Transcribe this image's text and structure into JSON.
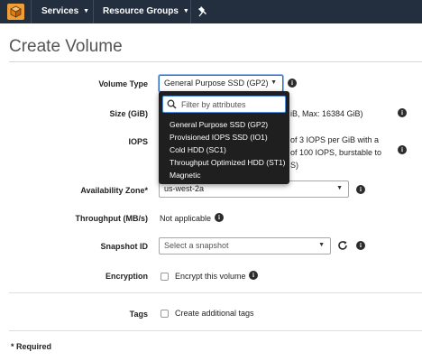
{
  "colors": {
    "topbar": "#232f3e",
    "logo": "#f19d36",
    "dropdown_bg": "#1f1f1f",
    "focus": "#2e6ecb"
  },
  "topbar": {
    "logo_icon": "aws-cube-icon",
    "services_label": "Services",
    "resource_groups_label": "Resource Groups",
    "pin_icon": "pin-icon"
  },
  "page": {
    "title": "Create Volume"
  },
  "form": {
    "volume_type": {
      "label": "Volume Type",
      "value": "General Purpose SSD (GP2)",
      "dropdown": {
        "filter_placeholder": "Filter by attributes",
        "options": [
          "General Purpose SSD (GP2)",
          "Provisioned IOPS SSD (IO1)",
          "Cold HDD (SC1)",
          "Throughput Optimized HDD (ST1)",
          "Magnetic"
        ]
      }
    },
    "size": {
      "label": "Size (GiB)",
      "hint": "iB, Max: 16384 GiB)"
    },
    "iops": {
      "label": "IOPS",
      "hint_line1": "of 3 IOPS per GiB with a",
      "hint_line2": "of 100 IOPS, burstable to",
      "hint_line3": "S)"
    },
    "availability_zone": {
      "label": "Availability Zone*",
      "value": "us-west-2a"
    },
    "throughput": {
      "label": "Throughput (MB/s)",
      "value": "Not applicable"
    },
    "snapshot": {
      "label": "Snapshot ID",
      "placeholder": "Select a snapshot"
    },
    "encryption": {
      "label": "Encryption",
      "checkbox_label": "Encrypt this volume"
    },
    "tags": {
      "label": "Tags",
      "checkbox_label": "Create additional tags"
    }
  },
  "footer": {
    "required_note": "* Required"
  }
}
